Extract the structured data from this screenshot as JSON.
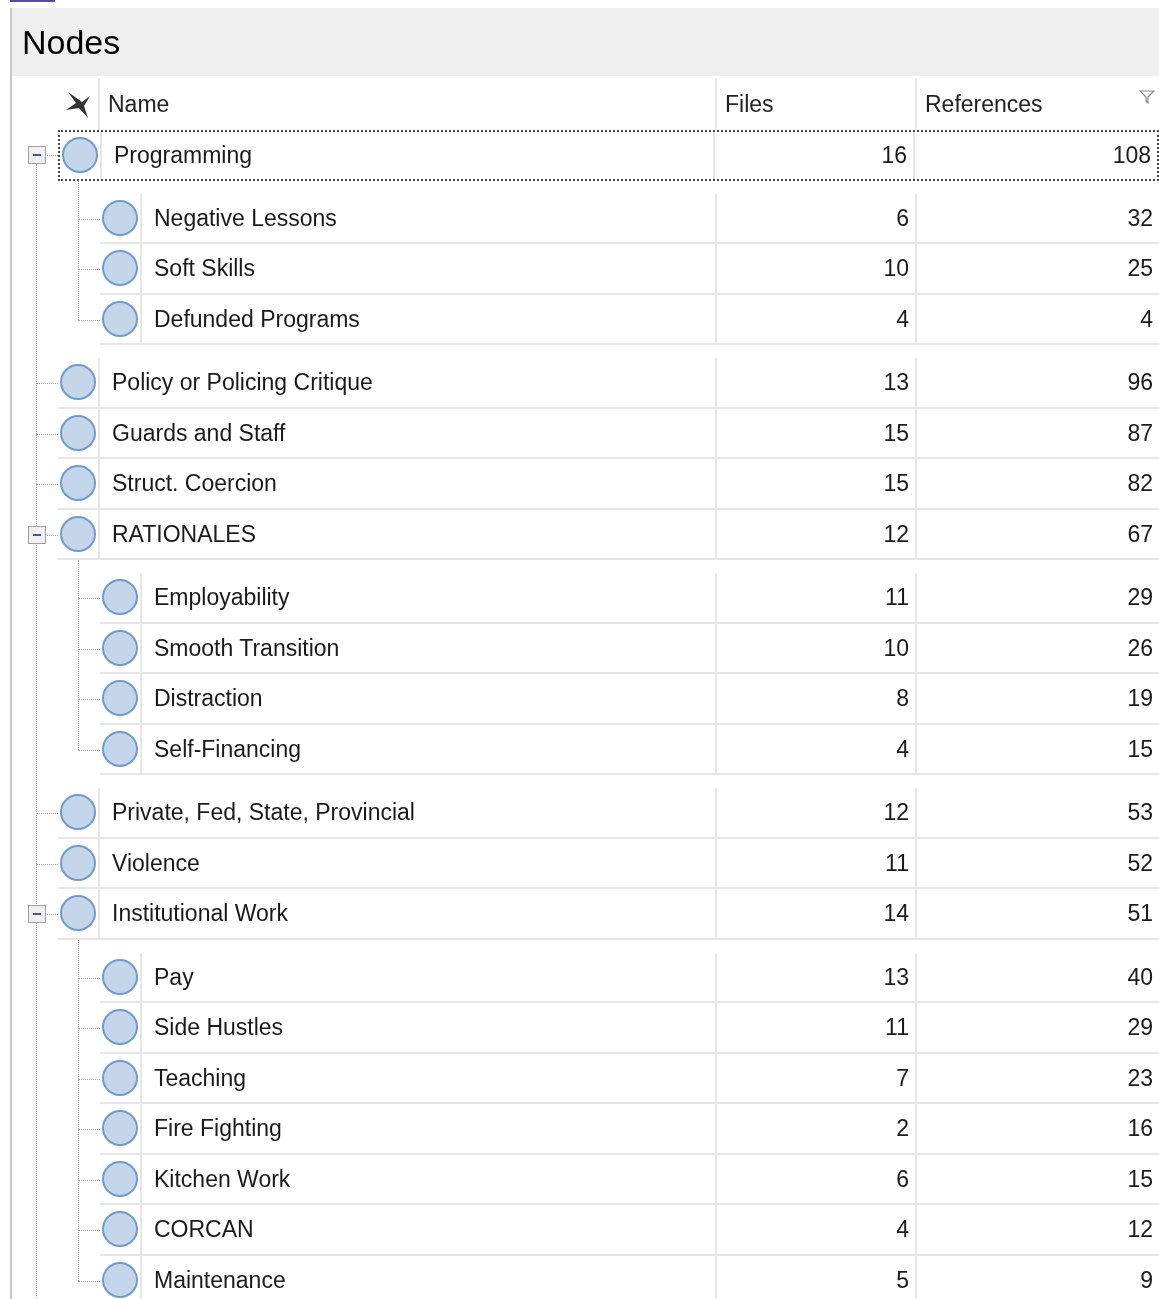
{
  "panel": {
    "title": "Nodes"
  },
  "columns": [
    {
      "label": "Name"
    },
    {
      "label": "Files"
    },
    {
      "label": "References"
    }
  ],
  "nodes": [
    {
      "name": "Programming",
      "files": "16",
      "references": "108",
      "selected": true,
      "expanded": true,
      "children": [
        {
          "name": "Negative Lessons",
          "files": "6",
          "references": "32",
          "selected": false
        },
        {
          "name": "Soft Skills",
          "files": "10",
          "references": "25",
          "selected": false
        },
        {
          "name": "Defunded Programs",
          "files": "4",
          "references": "4",
          "selected": false
        }
      ]
    },
    {
      "name": "Policy or Policing Critique",
      "files": "13",
      "references": "96",
      "selected": false
    },
    {
      "name": "Guards and Staff",
      "files": "15",
      "references": "87",
      "selected": false
    },
    {
      "name": "Struct. Coercion",
      "files": "15",
      "references": "82",
      "selected": false
    },
    {
      "name": "RATIONALES",
      "files": "12",
      "references": "67",
      "selected": false,
      "expanded": true,
      "children": [
        {
          "name": "Employability",
          "files": "11",
          "references": "29",
          "selected": false
        },
        {
          "name": "Smooth Transition",
          "files": "10",
          "references": "26",
          "selected": false
        },
        {
          "name": "Distraction",
          "files": "8",
          "references": "19",
          "selected": false
        },
        {
          "name": "Self-Financing",
          "files": "4",
          "references": "15",
          "selected": false
        }
      ]
    },
    {
      "name": "Private, Fed, State, Provincial",
      "files": "12",
      "references": "53",
      "selected": false
    },
    {
      "name": "Violence",
      "files": "11",
      "references": "52",
      "selected": false
    },
    {
      "name": "Institutional Work",
      "files": "14",
      "references": "51",
      "selected": false,
      "expanded": true,
      "children": [
        {
          "name": "Pay",
          "files": "13",
          "references": "40",
          "selected": false
        },
        {
          "name": "Side Hustles",
          "files": "11",
          "references": "29",
          "selected": false
        },
        {
          "name": "Teaching",
          "files": "7",
          "references": "23",
          "selected": false
        },
        {
          "name": "Fire Fighting",
          "files": "2",
          "references": "16",
          "selected": false
        },
        {
          "name": "Kitchen Work",
          "files": "6",
          "references": "15",
          "selected": false
        },
        {
          "name": "CORCAN",
          "files": "4",
          "references": "12",
          "selected": false
        },
        {
          "name": "Maintenance",
          "files": "5",
          "references": "9",
          "selected": false
        }
      ]
    }
  ]
}
